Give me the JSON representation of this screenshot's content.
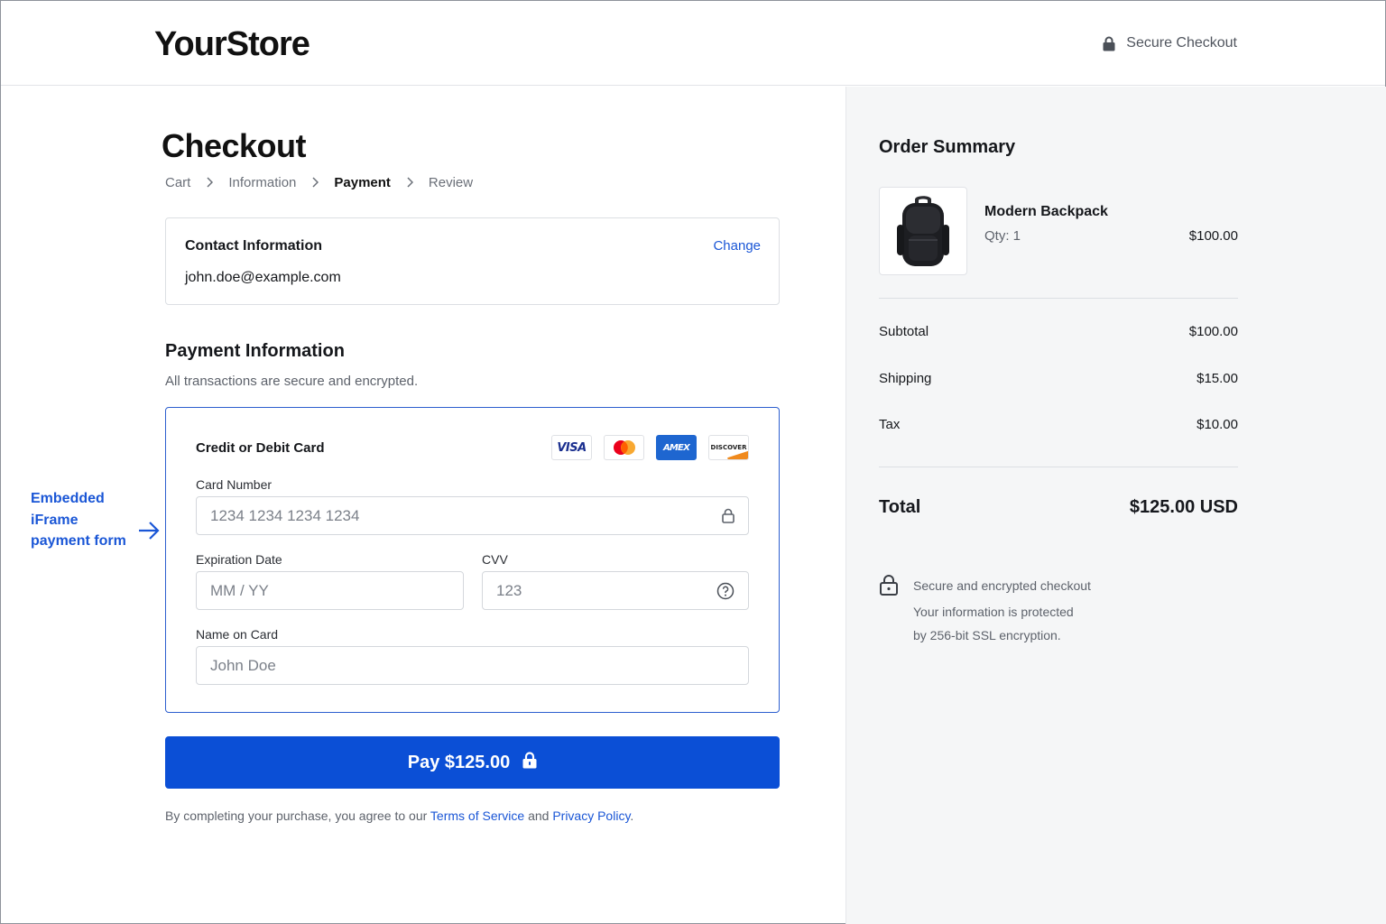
{
  "header": {
    "logo": "YourStore",
    "secure_label": "Secure Checkout"
  },
  "main": {
    "title": "Checkout",
    "breadcrumb": [
      {
        "label": "Cart",
        "active": false
      },
      {
        "label": "Information",
        "active": false
      },
      {
        "label": "Payment",
        "active": true
      },
      {
        "label": "Review",
        "active": false
      }
    ],
    "contact": {
      "title": "Contact Information",
      "change_label": "Change",
      "email": "john.doe@example.com"
    },
    "payment": {
      "title": "Payment Information",
      "subtitle": "All transactions are secure and encrypted.",
      "card_title": "Credit or Debit Card",
      "brands": [
        "VISA",
        "mastercard",
        "AMEX",
        "DISCOVER"
      ],
      "card_number_label": "Card Number",
      "card_number_placeholder": "1234 1234 1234 1234",
      "expiry_label": "Expiration Date",
      "expiry_placeholder": "MM / YY",
      "cvv_label": "CVV",
      "cvv_placeholder": "123",
      "name_label": "Name on Card",
      "name_placeholder": "John Doe"
    },
    "pay_button": "Pay $125.00",
    "legal": {
      "prefix": "By completing your purchase, you agree to our",
      "terms": "Terms of Service",
      "and": "and",
      "privacy": "Privacy Policy",
      "suffix": "."
    },
    "annotation": "Embedded iFrame payment form"
  },
  "summary": {
    "title": "Order Summary",
    "item": {
      "name": "Modern Backpack",
      "qty": "Qty: 1",
      "price": "$100.00"
    },
    "subtotal_label": "Subtotal",
    "subtotal_value": "$100.00",
    "shipping_label": "Shipping",
    "shipping_value": "$15.00",
    "tax_label": "Tax",
    "tax_value": "$10.00",
    "total_label": "Total",
    "total_value": "$125.00 USD",
    "secure_note": {
      "title": "Secure and encrypted checkout",
      "line1": "Your information is protected",
      "line2": "by 256-bit SSL encryption."
    }
  },
  "colors": {
    "accent": "#0b4fd6",
    "link": "#1a56d6",
    "panel_bg": "#f5f6f7"
  }
}
